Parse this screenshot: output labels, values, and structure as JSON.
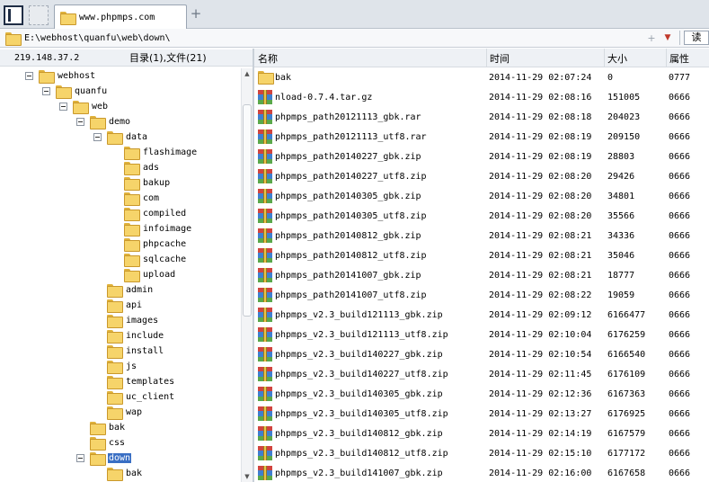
{
  "tab": {
    "title": "www.phpmps.com"
  },
  "address": {
    "path": "E:\\webhost\\quanfu\\web\\down\\",
    "plus_icon": "+",
    "dropdown_icon": "▼",
    "read_label": "读"
  },
  "left_info": {
    "ip": "219.148.37.2",
    "counts": "目录(1),文件(21)"
  },
  "tree": [
    {
      "label": "webhost",
      "indent": 1,
      "expander": true,
      "selected": false
    },
    {
      "label": "quanfu",
      "indent": 2,
      "expander": true,
      "selected": false
    },
    {
      "label": "web",
      "indent": 3,
      "expander": true,
      "selected": false
    },
    {
      "label": "demo",
      "indent": 4,
      "expander": true,
      "selected": false
    },
    {
      "label": "data",
      "indent": 5,
      "expander": true,
      "selected": false
    },
    {
      "label": "flashimage",
      "indent": 6,
      "expander": false,
      "selected": false
    },
    {
      "label": "ads",
      "indent": 6,
      "expander": false,
      "selected": false
    },
    {
      "label": "bakup",
      "indent": 6,
      "expander": false,
      "selected": false
    },
    {
      "label": "com",
      "indent": 6,
      "expander": false,
      "selected": false
    },
    {
      "label": "compiled",
      "indent": 6,
      "expander": false,
      "selected": false
    },
    {
      "label": "infoimage",
      "indent": 6,
      "expander": false,
      "selected": false
    },
    {
      "label": "phpcache",
      "indent": 6,
      "expander": false,
      "selected": false
    },
    {
      "label": "sqlcache",
      "indent": 6,
      "expander": false,
      "selected": false
    },
    {
      "label": "upload",
      "indent": 6,
      "expander": false,
      "selected": false
    },
    {
      "label": "admin",
      "indent": 5,
      "expander": false,
      "selected": false
    },
    {
      "label": "api",
      "indent": 5,
      "expander": false,
      "selected": false
    },
    {
      "label": "images",
      "indent": 5,
      "expander": false,
      "selected": false
    },
    {
      "label": "include",
      "indent": 5,
      "expander": false,
      "selected": false
    },
    {
      "label": "install",
      "indent": 5,
      "expander": false,
      "selected": false
    },
    {
      "label": "js",
      "indent": 5,
      "expander": false,
      "selected": false
    },
    {
      "label": "templates",
      "indent": 5,
      "expander": false,
      "selected": false
    },
    {
      "label": "uc_client",
      "indent": 5,
      "expander": false,
      "selected": false
    },
    {
      "label": "wap",
      "indent": 5,
      "expander": false,
      "selected": false
    },
    {
      "label": "bak",
      "indent": 4,
      "expander": false,
      "selected": false
    },
    {
      "label": "css",
      "indent": 4,
      "expander": false,
      "selected": false
    },
    {
      "label": "down",
      "indent": 4,
      "expander": true,
      "selected": true
    },
    {
      "label": "bak",
      "indent": 5,
      "expander": false,
      "selected": false
    }
  ],
  "list": {
    "headers": {
      "name": "名称",
      "time": "时间",
      "size": "大小",
      "attr": "属性"
    },
    "rows": [
      {
        "type": "folder",
        "name": "bak",
        "time": "2014-11-29 02:07:24",
        "size": "0",
        "attr": "0777"
      },
      {
        "type": "archive",
        "name": "nload-0.7.4.tar.gz",
        "time": "2014-11-29 02:08:16",
        "size": "151005",
        "attr": "0666"
      },
      {
        "type": "archive",
        "name": "phpmps_path20121113_gbk.rar",
        "time": "2014-11-29 02:08:18",
        "size": "204023",
        "attr": "0666"
      },
      {
        "type": "archive",
        "name": "phpmps_path20121113_utf8.rar",
        "time": "2014-11-29 02:08:19",
        "size": "209150",
        "attr": "0666"
      },
      {
        "type": "archive",
        "name": "phpmps_path20140227_gbk.zip",
        "time": "2014-11-29 02:08:19",
        "size": "28803",
        "attr": "0666"
      },
      {
        "type": "archive",
        "name": "phpmps_path20140227_utf8.zip",
        "time": "2014-11-29 02:08:20",
        "size": "29426",
        "attr": "0666"
      },
      {
        "type": "archive",
        "name": "phpmps_path20140305_gbk.zip",
        "time": "2014-11-29 02:08:20",
        "size": "34801",
        "attr": "0666"
      },
      {
        "type": "archive",
        "name": "phpmps_path20140305_utf8.zip",
        "time": "2014-11-29 02:08:20",
        "size": "35566",
        "attr": "0666"
      },
      {
        "type": "archive",
        "name": "phpmps_path20140812_gbk.zip",
        "time": "2014-11-29 02:08:21",
        "size": "34336",
        "attr": "0666"
      },
      {
        "type": "archive",
        "name": "phpmps_path20140812_utf8.zip",
        "time": "2014-11-29 02:08:21",
        "size": "35046",
        "attr": "0666"
      },
      {
        "type": "archive",
        "name": "phpmps_path20141007_gbk.zip",
        "time": "2014-11-29 02:08:21",
        "size": "18777",
        "attr": "0666"
      },
      {
        "type": "archive",
        "name": "phpmps_path20141007_utf8.zip",
        "time": "2014-11-29 02:08:22",
        "size": "19059",
        "attr": "0666"
      },
      {
        "type": "archive",
        "name": "phpmps_v2.3_build121113_gbk.zip",
        "time": "2014-11-29 02:09:12",
        "size": "6166477",
        "attr": "0666"
      },
      {
        "type": "archive",
        "name": "phpmps_v2.3_build121113_utf8.zip",
        "time": "2014-11-29 02:10:04",
        "size": "6176259",
        "attr": "0666"
      },
      {
        "type": "archive",
        "name": "phpmps_v2.3_build140227_gbk.zip",
        "time": "2014-11-29 02:10:54",
        "size": "6166540",
        "attr": "0666"
      },
      {
        "type": "archive",
        "name": "phpmps_v2.3_build140227_utf8.zip",
        "time": "2014-11-29 02:11:45",
        "size": "6176109",
        "attr": "0666"
      },
      {
        "type": "archive",
        "name": "phpmps_v2.3_build140305_gbk.zip",
        "time": "2014-11-29 02:12:36",
        "size": "6167363",
        "attr": "0666"
      },
      {
        "type": "archive",
        "name": "phpmps_v2.3_build140305_utf8.zip",
        "time": "2014-11-29 02:13:27",
        "size": "6176925",
        "attr": "0666"
      },
      {
        "type": "archive",
        "name": "phpmps_v2.3_build140812_gbk.zip",
        "time": "2014-11-29 02:14:19",
        "size": "6167579",
        "attr": "0666"
      },
      {
        "type": "archive",
        "name": "phpmps_v2.3_build140812_utf8.zip",
        "time": "2014-11-29 02:15:10",
        "size": "6177172",
        "attr": "0666"
      },
      {
        "type": "archive",
        "name": "phpmps_v2.3_build141007_gbk.zip",
        "time": "2014-11-29 02:16:00",
        "size": "6167658",
        "attr": "0666"
      }
    ]
  },
  "scrollbar": {
    "up_icon": "▲",
    "down_icon": "▼"
  }
}
